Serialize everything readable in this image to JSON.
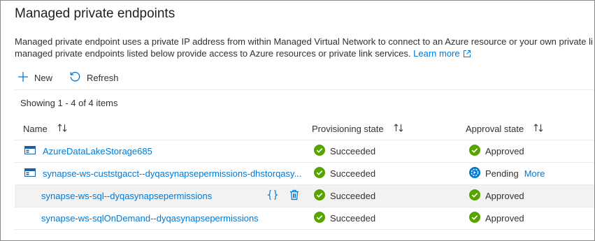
{
  "page": {
    "title": "Managed private endpoints",
    "description_line1": "Managed private endpoint uses a private IP address from within Managed Virtual Network to connect to an Azure resource or your own private li",
    "description_line2": "managed private endpoints listed below provide access to Azure resources or private link services.",
    "learn_more": "Learn more"
  },
  "toolbar": {
    "new_label": "New",
    "refresh_label": "Refresh"
  },
  "grid": {
    "count_text": "Showing 1 - 4 of 4 items",
    "columns": {
      "name": "Name",
      "provisioning": "Provisioning state",
      "approval": "Approval state"
    },
    "rows": [
      {
        "name": "AzureDataLakeStorage685",
        "provisioning": "Succeeded",
        "approval": "Approved",
        "approval_more": ""
      },
      {
        "name": "synapse-ws-custstgacct--dyqasynapsepermissions-dhstorqasy...",
        "provisioning": "Succeeded",
        "approval": "Pending",
        "approval_more": "More"
      },
      {
        "name": "synapse-ws-sql--dyqasynapsepermissions",
        "provisioning": "Succeeded",
        "approval": "Approved",
        "approval_more": ""
      },
      {
        "name": "synapse-ws-sqlOnDemand--dyqasynapsepermissions",
        "provisioning": "Succeeded",
        "approval": "Approved",
        "approval_more": ""
      }
    ]
  },
  "colors": {
    "accent": "#0078d4",
    "success": "#57a300",
    "pending": "#0078d4",
    "selected_row": "#f3f2f1"
  }
}
